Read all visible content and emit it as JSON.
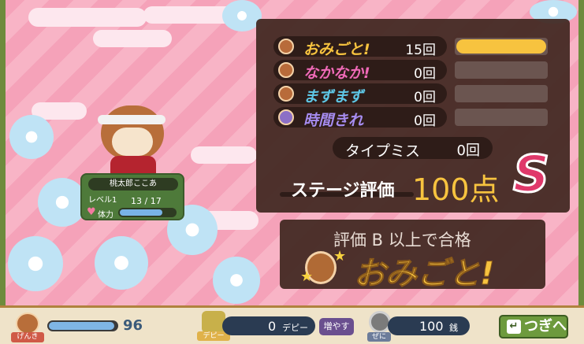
{
  "results": {
    "rows": [
      {
        "label": "おみごと!",
        "count": "15回",
        "color": "#f7c33f",
        "icon": "cheer-face-icon",
        "progress": 1.0
      },
      {
        "label": "なかなか!",
        "count": "0回",
        "color": "#f06ab8",
        "icon": "happy-face-icon",
        "progress": 0
      },
      {
        "label": "まずまず",
        "count": "0回",
        "color": "#5ec7e6",
        "icon": "neutral-face-icon",
        "progress": 0
      },
      {
        "label": "時間きれ",
        "count": "0回",
        "color": "#a68cf0",
        "icon": "dizzy-face-icon",
        "progress": 0
      }
    ],
    "typo_label": "タイプミス",
    "typo_count": "0回",
    "stage_eval_label": "ステージ評価",
    "stage_score": "100点",
    "rank": "S"
  },
  "pass": {
    "requirement": "評価 B 以上で合格",
    "verdict": "おみごと!"
  },
  "character": {
    "name": "桃太郎ここあ",
    "level": "レベル1",
    "hp_text": "13 / 17",
    "hp_ratio": 0.765,
    "stamina_label": "体力"
  },
  "bottom": {
    "genki_label": "げんき",
    "genki_value": "96",
    "genki_ratio": 0.96,
    "dp_value": "0",
    "dp_unit": "デピー",
    "dp_label": "デピー",
    "increase_label": "増やす",
    "coin_value": "100",
    "coin_unit": "銭",
    "coin_label": "ぜに",
    "next_label": "つぎへ"
  }
}
